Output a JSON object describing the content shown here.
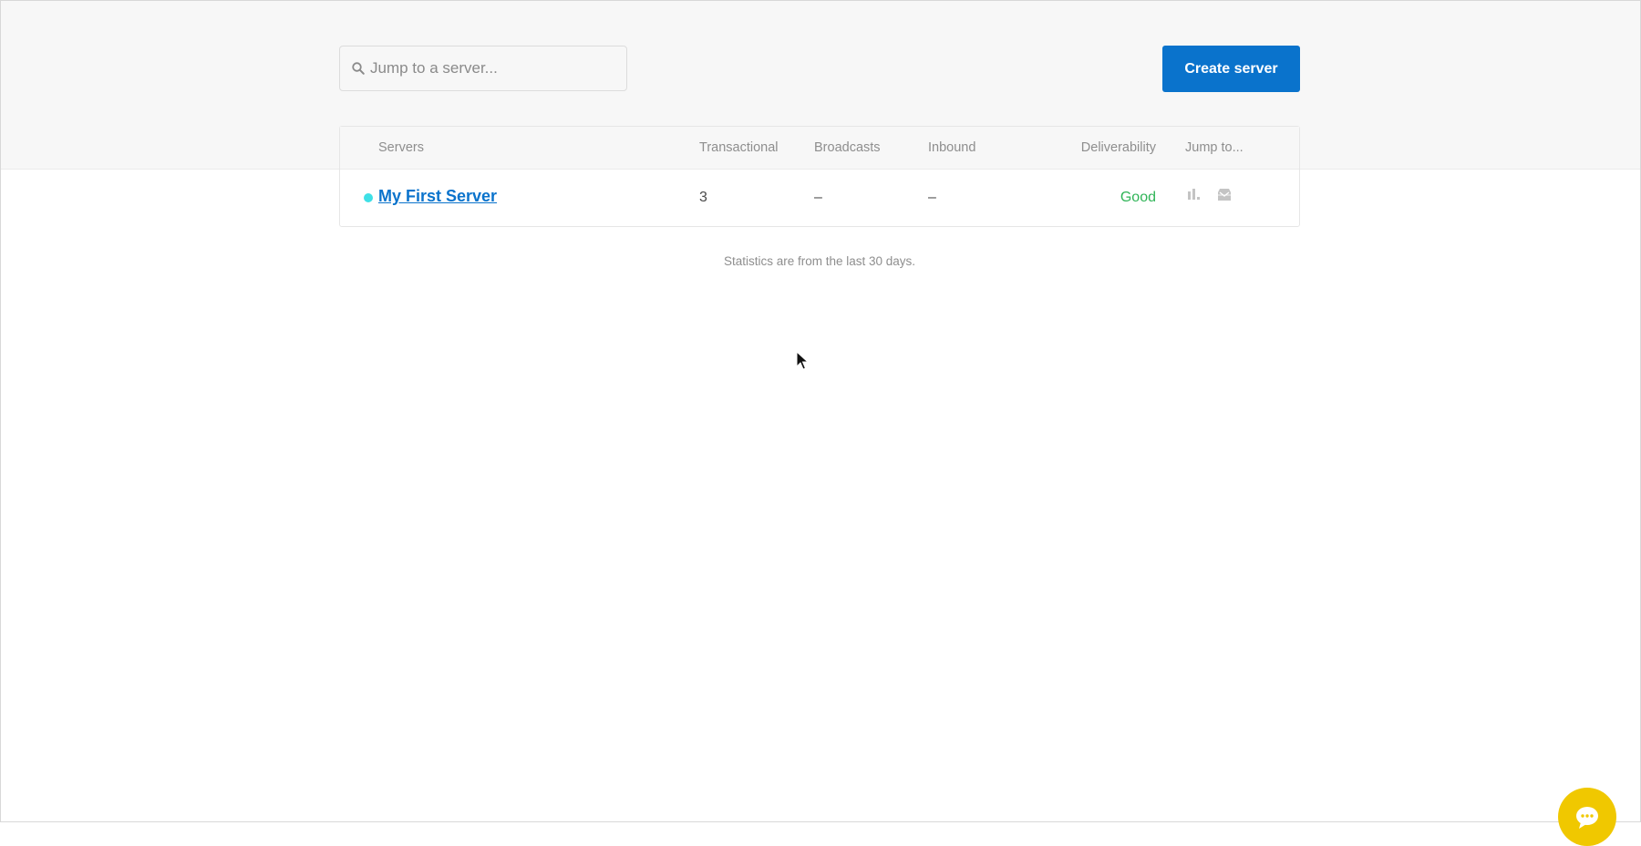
{
  "search": {
    "placeholder": "Jump to a server...",
    "icon": "search-icon"
  },
  "toolbar": {
    "create_label": "Create server"
  },
  "table": {
    "columns": {
      "servers": "Servers",
      "transactional": "Transactional",
      "broadcasts": "Broadcasts",
      "inbound": "Inbound",
      "deliverability": "Deliverability",
      "jump_to": "Jump to..."
    },
    "rows": [
      {
        "name": "My First Server",
        "status_color": "#3ee0e6",
        "transactional": "3",
        "broadcasts": "–",
        "inbound": "–",
        "deliverability": "Good",
        "jump_icons": [
          "bar-chart-icon",
          "inbox-icon"
        ]
      }
    ]
  },
  "footnote": "Statistics are from the last 30 days.",
  "colors": {
    "accent": "#0a73cc",
    "good": "#2fb457",
    "status_dot": "#3ee0e6",
    "chat": "#f0c800"
  },
  "chat": {
    "icon": "chat-icon"
  }
}
